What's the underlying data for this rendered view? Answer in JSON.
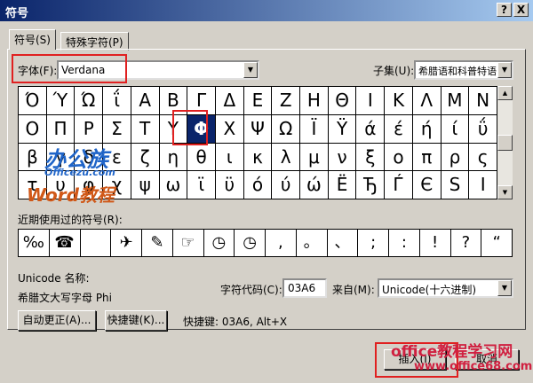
{
  "window": {
    "title": "符号",
    "help": "?",
    "close": "X"
  },
  "tabs": [
    "符号(S)",
    "特殊字符(P)"
  ],
  "font": {
    "label": "字体(F):",
    "value": "Verdana"
  },
  "subset": {
    "label": "子集(U):",
    "value": "希腊语和科普特语"
  },
  "grid": [
    [
      "Ό",
      "Ύ",
      "Ώ",
      "ΐ",
      "Α",
      "Β",
      "Γ",
      "Δ",
      "Ε",
      "Ζ",
      "Η",
      "Θ",
      "Ι",
      "Κ",
      "Λ",
      "Μ",
      "Ν"
    ],
    [
      "Ο",
      "Π",
      "Ρ",
      "Σ",
      "Τ",
      "Υ",
      "Φ",
      "Χ",
      "Ψ",
      "Ω",
      "Ϊ",
      "Ϋ",
      "ά",
      "έ",
      "ή",
      "ί",
      "ΰ"
    ],
    [
      "β",
      "γ",
      "δ",
      "ε",
      "ζ",
      "η",
      "θ",
      "ι",
      "κ",
      "λ",
      "μ",
      "ν",
      "ξ",
      "ο",
      "π",
      "ρ",
      "ς"
    ],
    [
      "τ",
      "υ",
      "φ",
      "χ",
      "ψ",
      "ω",
      "ϊ",
      "ϋ",
      "ό",
      "ύ",
      "ώ",
      "Ë",
      "Ђ",
      "Ѓ",
      "Є",
      "Ѕ",
      "І",
      "Ї"
    ]
  ],
  "selected_symbol": "Φ",
  "recent": {
    "label": "近期使用过的符号(R):",
    "symbols": [
      "‰",
      "☎",
      "",
      "✈",
      "✎",
      "☞",
      "◷",
      "◷",
      ",",
      "。",
      "、",
      ";",
      ":",
      "!",
      "?",
      "“",
      "”",
      "("
    ]
  },
  "unicode_name": {
    "label": "Unicode 名称:",
    "value": "希腊文大写字母 Phi"
  },
  "char_code": {
    "label": "字符代码(C):",
    "value": "03A6"
  },
  "from": {
    "label": "来自(M):",
    "value": "Unicode(十六进制)"
  },
  "buttons": {
    "autocorrect": "自动更正(A)...",
    "shortcut_key": "快捷键(K)...",
    "insert": "插入(I)",
    "cancel": "取消"
  },
  "shortcut_text": "快捷键: 03A6, Alt+X",
  "watermarks": {
    "site1": "办公族",
    "site1_url": "Officezu.com",
    "site1_sub": "Word教程",
    "site2": "office教程学习网",
    "site2_url": "www.office68.com"
  }
}
